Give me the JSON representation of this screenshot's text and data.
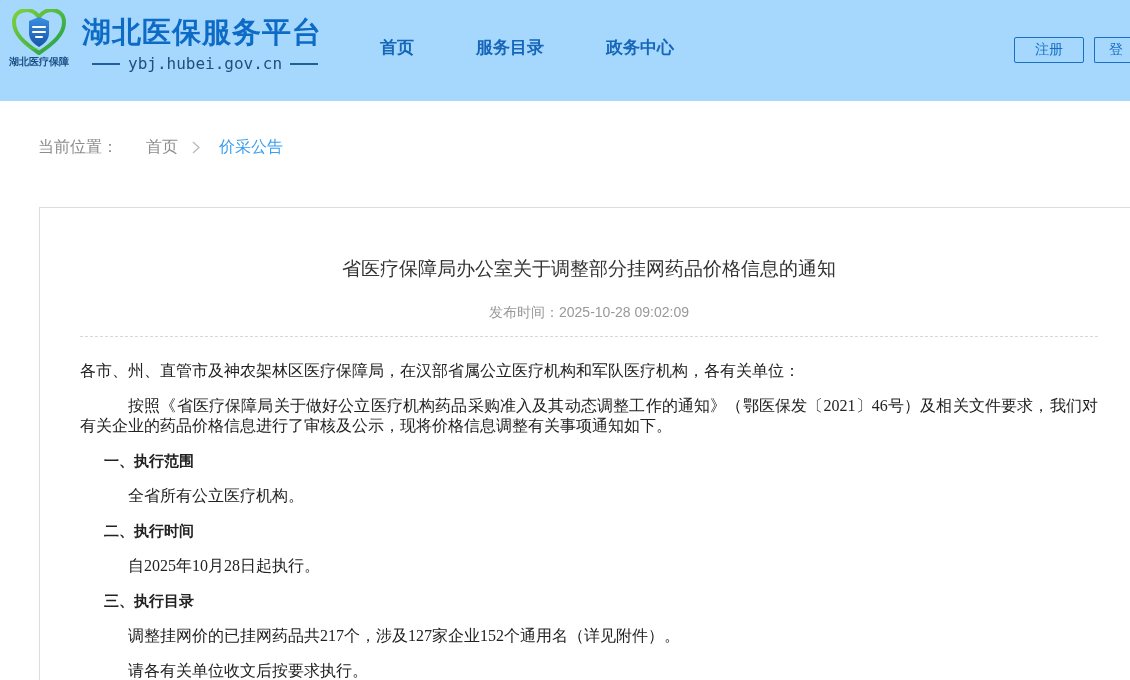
{
  "header": {
    "logo": {
      "caption": "湖北医疗保障"
    },
    "site_title": "湖北医保服务平台",
    "site_url": "ybj.hubei.gov.cn",
    "nav": [
      {
        "label": "首页"
      },
      {
        "label": "服务目录"
      },
      {
        "label": "政务中心"
      }
    ],
    "account_buttons": [
      {
        "label": "注册"
      },
      {
        "label": "登"
      }
    ]
  },
  "breadcrumb": {
    "label": "当前位置：",
    "items": [
      {
        "label": "首页",
        "selected": false
      },
      {
        "label": "价采公告",
        "selected": true
      }
    ]
  },
  "article": {
    "title": "省医疗保障局办公室关于调整部分挂网药品价格信息的通知",
    "published": "发布时间：2025-10-28 09:02:09",
    "blocks": [
      {
        "kind": "salutation",
        "text": "各市、州、直管市及神农架林区医疗保障局，在汉部省属公立医疗机构和军队医疗机构，各有关单位："
      },
      {
        "kind": "paragraph",
        "text": "按照《省医疗保障局关于做好公立医疗机构药品采购准入及其动态调整工作的通知》（鄂医保发〔2021〕46号）及相关文件要求，我们对有关企业的药品价格信息进行了审核及公示，现将价格信息调整有关事项通知如下。"
      },
      {
        "kind": "heading",
        "text": "一、执行范围"
      },
      {
        "kind": "paragraph",
        "text": "全省所有公立医疗机构。"
      },
      {
        "kind": "heading",
        "text": "二、执行时间"
      },
      {
        "kind": "paragraph",
        "text": "自2025年10月28日起执行。"
      },
      {
        "kind": "heading",
        "text": "三、执行目录"
      },
      {
        "kind": "paragraph",
        "text": "调整挂网价的已挂网药品共217个，涉及127家企业152个通用名（详见附件）。"
      },
      {
        "kind": "paragraph",
        "text": "请各有关单位收文后按要求执行。"
      }
    ]
  }
}
